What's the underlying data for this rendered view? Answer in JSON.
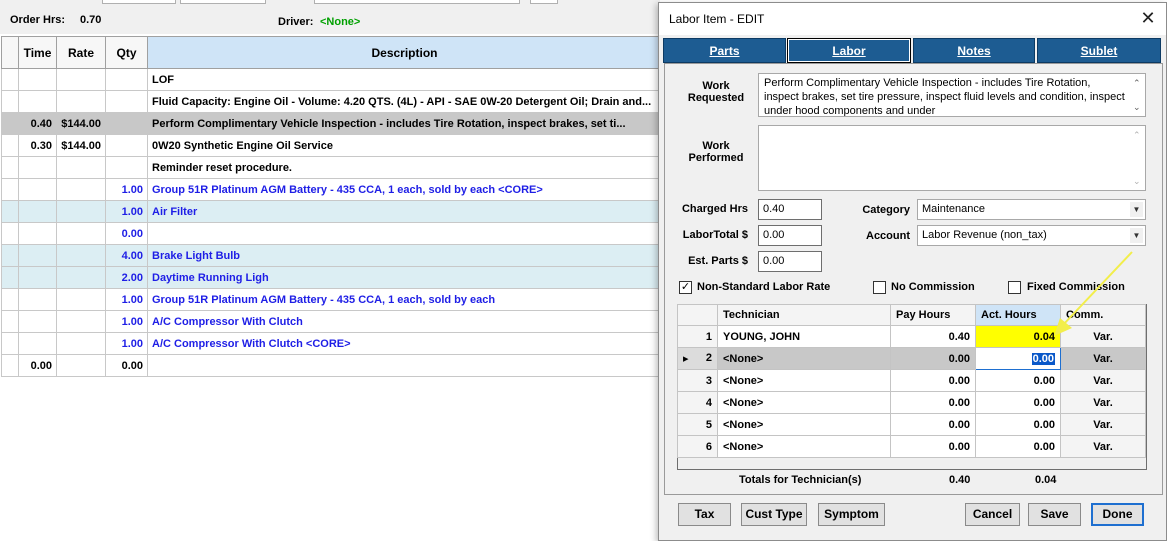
{
  "header": {
    "order_hrs_label": "Order Hrs:",
    "order_hrs_value": "0.70",
    "driver_label": "Driver:",
    "driver_value": "<None>"
  },
  "grid": {
    "columns": [
      "Time",
      "Rate",
      "Qty",
      "Description"
    ],
    "rows": [
      {
        "time": "",
        "rate": "",
        "qty": "",
        "desc": "LOF",
        "style": ""
      },
      {
        "time": "",
        "rate": "",
        "qty": "",
        "desc": "Fluid Capacity:  Engine Oil - Volume: 4.20 QTS. (4L) - API - SAE 0W-20 Detergent Oil; Drain and...",
        "style": ""
      },
      {
        "time": "0.40",
        "rate": "$144.00",
        "qty": "",
        "desc": "Perform Complimentary Vehicle Inspection - includes Tire Rotation, inspect brakes, set ti...",
        "style": "sel"
      },
      {
        "time": "0.30",
        "rate": "$144.00",
        "qty": "",
        "desc": "0W20 Synthetic Engine Oil Service",
        "style": ""
      },
      {
        "time": "",
        "rate": "",
        "qty": "",
        "desc": "Reminder reset procedure.",
        "style": ""
      },
      {
        "time": "",
        "rate": "",
        "qty": "1.00",
        "desc": "Group 51R Platinum AGM Battery - 435 CCA, 1 each, sold by each <CORE>",
        "style": "part"
      },
      {
        "time": "",
        "rate": "",
        "qty": "1.00",
        "desc": "Air Filter",
        "style": "part alt"
      },
      {
        "time": "",
        "rate": "",
        "qty": "0.00",
        "desc": "",
        "style": "part"
      },
      {
        "time": "",
        "rate": "",
        "qty": "4.00",
        "desc": "Brake Light Bulb",
        "style": "part alt"
      },
      {
        "time": "",
        "rate": "",
        "qty": "2.00",
        "desc": "Daytime Running Ligh",
        "style": "part alt"
      },
      {
        "time": "",
        "rate": "",
        "qty": "1.00",
        "desc": "Group 51R Platinum AGM Battery - 435 CCA, 1 each, sold by each",
        "style": "part"
      },
      {
        "time": "",
        "rate": "",
        "qty": "1.00",
        "desc": "A/C Compressor With Clutch",
        "style": "part"
      },
      {
        "time": "",
        "rate": "",
        "qty": "1.00",
        "desc": "A/C Compressor With Clutch <CORE>",
        "style": "part"
      },
      {
        "time": "0.00",
        "rate": "",
        "qty": "0.00",
        "desc": "",
        "style": ""
      }
    ]
  },
  "dialog": {
    "title": "Labor Item - EDIT",
    "tabs": [
      "Parts",
      "Labor",
      "Notes",
      "Sublet"
    ],
    "work_requested_label": "Work Requested",
    "work_requested_text": "Perform Complimentary Vehicle Inspection - includes Tire Rotation, inspect brakes, set tire pressure, inspect fluid levels and condition, inspect under hood components and under",
    "work_performed_label": "Work Performed",
    "work_performed_text": "",
    "charged_hrs_label": "Charged Hrs",
    "charged_hrs_value": "0.40",
    "labor_total_label": "LaborTotal $",
    "labor_total_value": "0.00",
    "est_parts_label": "Est. Parts $",
    "est_parts_value": "0.00",
    "category_label": "Category",
    "category_value": "Maintenance",
    "account_label": "Account",
    "account_value": "Labor Revenue (non_tax)",
    "non_standard_label": "Non-Standard Labor Rate",
    "non_standard_checked": true,
    "no_commission_label": "No Commission",
    "fixed_commission_label": "Fixed Commission",
    "tech_columns": [
      "Technician",
      "Pay Hours",
      "Act. Hours",
      "Comm."
    ],
    "tech_rows": [
      {
        "n": "1",
        "tech": "YOUNG, JOHN",
        "pay": "0.40",
        "act": "0.04",
        "comm": "Var."
      },
      {
        "n": "2",
        "tech": "<None>",
        "pay": "0.00",
        "act": "0.00",
        "comm": "Var."
      },
      {
        "n": "3",
        "tech": "<None>",
        "pay": "0.00",
        "act": "0.00",
        "comm": "Var."
      },
      {
        "n": "4",
        "tech": "<None>",
        "pay": "0.00",
        "act": "0.00",
        "comm": "Var."
      },
      {
        "n": "5",
        "tech": "<None>",
        "pay": "0.00",
        "act": "0.00",
        "comm": "Var."
      },
      {
        "n": "6",
        "tech": "<None>",
        "pay": "0.00",
        "act": "0.00",
        "comm": "Var."
      }
    ],
    "totals_label": "Totals for Technician(s)",
    "totals_pay": "0.40",
    "totals_act": "0.04",
    "buttons": {
      "tax": "Tax",
      "cust_type": "Cust Type",
      "symptom": "Symptom",
      "cancel": "Cancel",
      "save": "Save",
      "done": "Done"
    }
  },
  "colors": {
    "tab_blue": "#1d5c92",
    "highlight_yellow": "#ffff00",
    "part_text_blue": "#1e1ee6",
    "driver_green": "#00a000"
  }
}
